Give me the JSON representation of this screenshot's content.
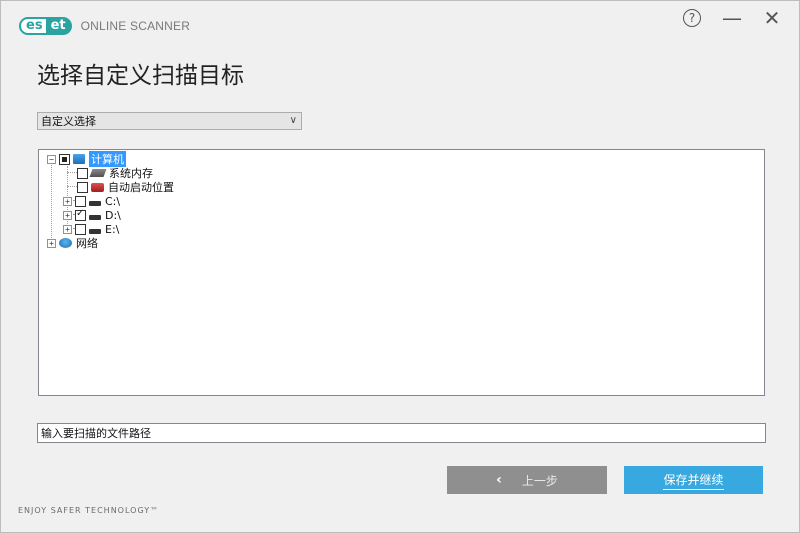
{
  "header": {
    "logo_left": "es",
    "logo_right": "et",
    "product": "ONLINE SCANNER",
    "help_icon": "help-icon",
    "minimize_icon": "minimize-icon",
    "close_icon": "close-icon"
  },
  "title": "选择自定义扫描目标",
  "profile_select": {
    "value": "自定义选择"
  },
  "tree": {
    "root": {
      "label": "计算机",
      "state": "partial",
      "expanded": true
    },
    "items": [
      {
        "label": "系统内存",
        "state": "unchecked"
      },
      {
        "label": "自动启动位置",
        "state": "unchecked"
      },
      {
        "label": "C:\\",
        "state": "unchecked"
      },
      {
        "label": "D:\\",
        "state": "checked"
      },
      {
        "label": "E:\\",
        "state": "unchecked"
      }
    ],
    "network": {
      "label": "网络"
    }
  },
  "path_input": {
    "value": "输入要扫描的文件路径"
  },
  "buttons": {
    "back": "上一步",
    "next": "保存并继续"
  },
  "footer": "ENJOY SAFER TECHNOLOGY™",
  "colors": {
    "brand": "#2aa3a1",
    "primary_button": "#37a9e0",
    "secondary_button": "#8f8f8f",
    "selection": "#3399ff"
  }
}
